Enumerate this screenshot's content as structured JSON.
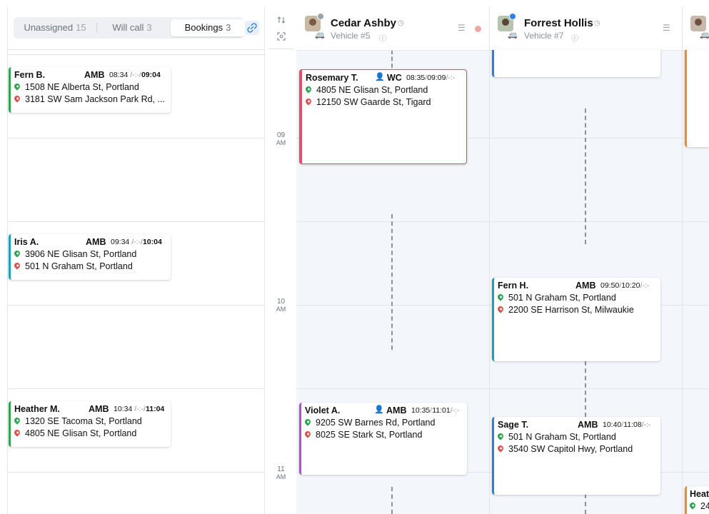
{
  "tabs": [
    {
      "label": "Unassigned",
      "count": "15"
    },
    {
      "label": "Will call",
      "count": "3"
    },
    {
      "label": "Bookings",
      "count": "3"
    }
  ],
  "icons": {
    "link": "link-icon",
    "sort": "sort-arrows-icon",
    "focus": "focus-icon"
  },
  "hours": [
    {
      "h": "09",
      "ampm": "AM"
    },
    {
      "h": "10",
      "ampm": "AM"
    },
    {
      "h": "11",
      "ampm": "AM"
    }
  ],
  "left_cards": [
    {
      "name": "Fern B.",
      "type": "AMB",
      "t1": "08:34",
      "t2": "-:-",
      "t3": "09:04",
      "from": "1508 NE Alberta St, Portland",
      "to": "3181 SW Sam Jackson Park Rd, ..."
    },
    {
      "name": "Iris A.",
      "type": "AMB",
      "t1": "09:34",
      "t2": "-:-",
      "t3": "10:04",
      "from": "3906 NE Glisan St, Portland",
      "to": "501 N Graham St, Portland"
    },
    {
      "name": "Heather M.",
      "type": "AMB",
      "t1": "10:34",
      "t2": "-:-",
      "t3": "11:04",
      "from": "1320 SE Tacoma St, Portland",
      "to": "4805 NE Glisan St, Portland"
    }
  ],
  "drivers": [
    {
      "name": "Cedar Ashby",
      "vehicle": "Vehicle #5",
      "status_color": "#9ca3af",
      "alert_color": "#f2a5a5"
    },
    {
      "name": "Forrest Hollis",
      "vehicle": "Vehicle #7",
      "status_color": "#2f80ed"
    }
  ],
  "trips": {
    "rosemary": {
      "name": "Rosemary T.",
      "type": "WC",
      "t1": "08:35",
      "t2": "09:09",
      "t3": "-:-",
      "from": "4805 NE Glisan St, Portland",
      "to": "12150 SW Gaarde St, Tigard"
    },
    "violet": {
      "name": "Violet A.",
      "type": "AMB",
      "t1": "10:35",
      "t2": "11:01",
      "t3": "-:-",
      "from": "9205 SW Barnes Rd, Portland",
      "to": "8025 SE Stark St, Portland"
    },
    "fern_h": {
      "name": "Fern H.",
      "type": "AMB",
      "t1": "09:50",
      "t2": "10:20",
      "t3": "-:-",
      "from": "501 N Graham St, Portland",
      "to": "2200 SE Harrison St, Milwaukie"
    },
    "sage": {
      "name": "Sage T.",
      "type": "AMB",
      "t1": "10:40",
      "t2": "11:08",
      "t3": "-:-",
      "from": "501 N Graham St, Portland",
      "to": "3540 SW Capitol Hwy, Portland"
    },
    "heat": {
      "name": "Heat",
      "from": "24"
    }
  },
  "colors": {
    "green": "#2ea44f",
    "red_pin": "#d9534f",
    "wc": "#e04f6a",
    "purple": "#b04fd6",
    "teal": "#1aa3b8",
    "blue": "#2f7fd6",
    "orange": "#f08a24"
  }
}
